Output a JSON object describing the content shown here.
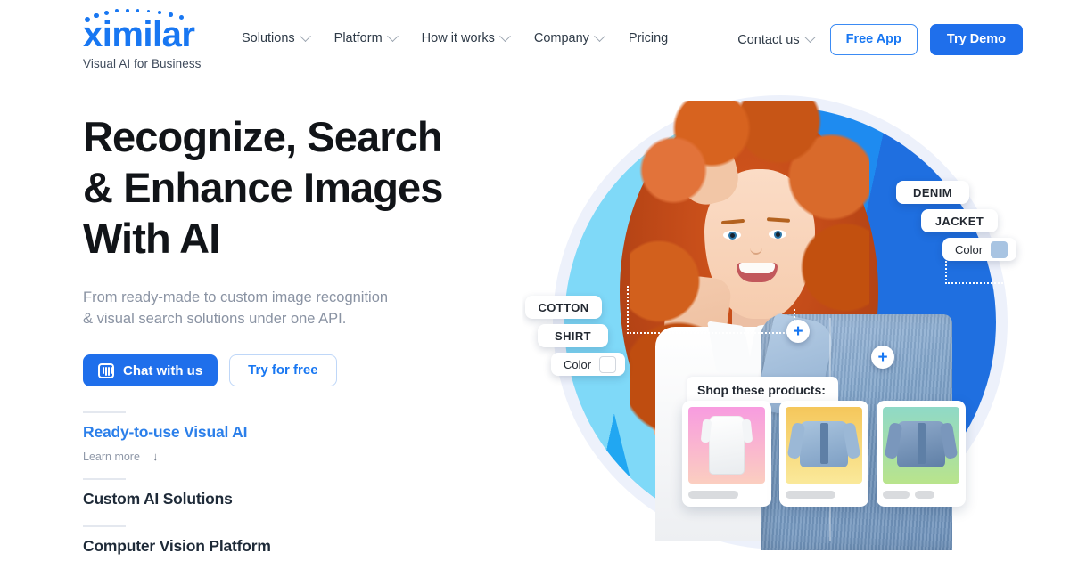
{
  "header": {
    "logo_word": "ximilar",
    "logo_tagline": "Visual AI for Business",
    "nav": [
      {
        "label": "Solutions",
        "has_dropdown": true
      },
      {
        "label": "Platform",
        "has_dropdown": true
      },
      {
        "label": "How it works",
        "has_dropdown": true
      },
      {
        "label": "Company",
        "has_dropdown": true
      },
      {
        "label": "Pricing",
        "has_dropdown": false
      }
    ],
    "contact_label": "Contact us",
    "free_app_label": "Free App",
    "try_demo_label": "Try Demo"
  },
  "hero": {
    "headline_line1": "Recognize, Search",
    "headline_line2": "& Enhance Images",
    "headline_line3": "With AI",
    "subtitle_line1": "From ready-made to custom image recognition",
    "subtitle_line2": "& visual search solutions under one API.",
    "chat_button_label": "Chat with us",
    "chat_button_icon": "intercom-chat-icon",
    "try_free_label": "Try for free",
    "accordion": [
      {
        "title": "Ready-to-use Visual AI",
        "active": true,
        "learn_more": "Learn more",
        "learn_more_icon": "arrow-down-icon"
      },
      {
        "title": "Custom AI Solutions",
        "active": false
      },
      {
        "title": "Computer Vision Platform",
        "active": false
      }
    ]
  },
  "art": {
    "tags_left": [
      {
        "label": "COTTON",
        "type": "text"
      },
      {
        "label": "SHIRT",
        "type": "text"
      },
      {
        "label": "Color",
        "type": "swatch",
        "swatch_color": "#FFFFFF"
      }
    ],
    "tags_right": [
      {
        "label": "DENIM",
        "type": "text"
      },
      {
        "label": "JACKET",
        "type": "text"
      },
      {
        "label": "Color",
        "type": "swatch",
        "swatch_color": "#A8C4E2"
      }
    ],
    "plus_markers": [
      {
        "name": "plus-marker-shirt",
        "glyph": "+"
      },
      {
        "name": "plus-marker-jacket",
        "glyph": "+"
      }
    ],
    "shop_label": "Shop these products:",
    "product_cards": [
      {
        "name": "white-shirt",
        "bg_from": "#F89CE0",
        "bg_to": "#FBCEC0",
        "garment": "shirt",
        "bars": [
          56
        ]
      },
      {
        "name": "denim-jacket-light",
        "bg_from": "#F5C75B",
        "bg_to": "#FAE99A",
        "garment": "jacket",
        "bars": [
          56
        ]
      },
      {
        "name": "denim-jacket-dark",
        "bg_from": "#8FD9C7",
        "bg_to": "#B9E48C",
        "garment": "jacket-dark",
        "bars": [
          30,
          22
        ]
      }
    ],
    "colors": {
      "circle_light_cyan": "#7FD9F8",
      "circle_mid_blue": "#21A7F2",
      "circle_deep_blue": "#1F6FE0",
      "halo_lavender": "#EDF1FB"
    }
  },
  "theme": {
    "brand_blue": "#1877F2",
    "button_blue": "#1F6FEB",
    "text_dark": "#111418",
    "text_muted": "#8A93A3"
  }
}
